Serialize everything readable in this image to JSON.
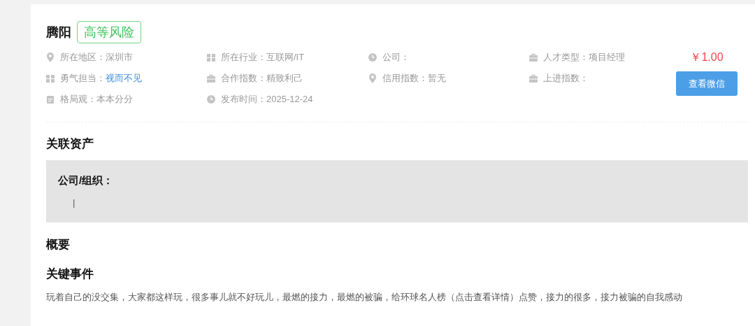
{
  "profile": {
    "name": "腾阳",
    "risk_badge": "高等风险",
    "fields": [
      {
        "kind": "location",
        "label": "所在地区：",
        "value": "深圳市",
        "link": false
      },
      {
        "kind": "grid",
        "label": "所在行业：",
        "value": "互联网/IT",
        "link": false
      },
      {
        "kind": "clock",
        "label": "公司："
      },
      {
        "kind": "briefcase",
        "label": "人才类型：",
        "value": "项目经理",
        "link": false
      },
      {
        "kind": "grid",
        "label": "勇气担当：",
        "value": "视而不见",
        "link": true
      },
      {
        "kind": "briefcase",
        "label": "合作指数：",
        "value": "精致利己",
        "link": false
      },
      {
        "kind": "location",
        "label": "信用指数：",
        "value": "暂无",
        "link": false
      },
      {
        "kind": "briefcase",
        "label": "上进指数："
      },
      {
        "kind": "calendar",
        "label": "格局观：",
        "value": "本本分分",
        "link": false
      },
      {
        "kind": "clock",
        "label": "发布时间：",
        "value": "2025-12-24",
        "link": false
      }
    ],
    "price": "￥1.00",
    "button": "查看微信"
  },
  "related_assets": {
    "title": "关联资产",
    "box_label": "公司/组织：",
    "box_value": "|"
  },
  "overview": {
    "title": "概要"
  },
  "key_events": {
    "title": "关键事件",
    "text": "玩着自己的没交集，大家都这样玩，很多事儿就不好玩儿，最燃的接力，最燃的被骗，给环球名人榜（点击查看详情）点赞，接力的很多，接力被骗的自我感动"
  }
}
